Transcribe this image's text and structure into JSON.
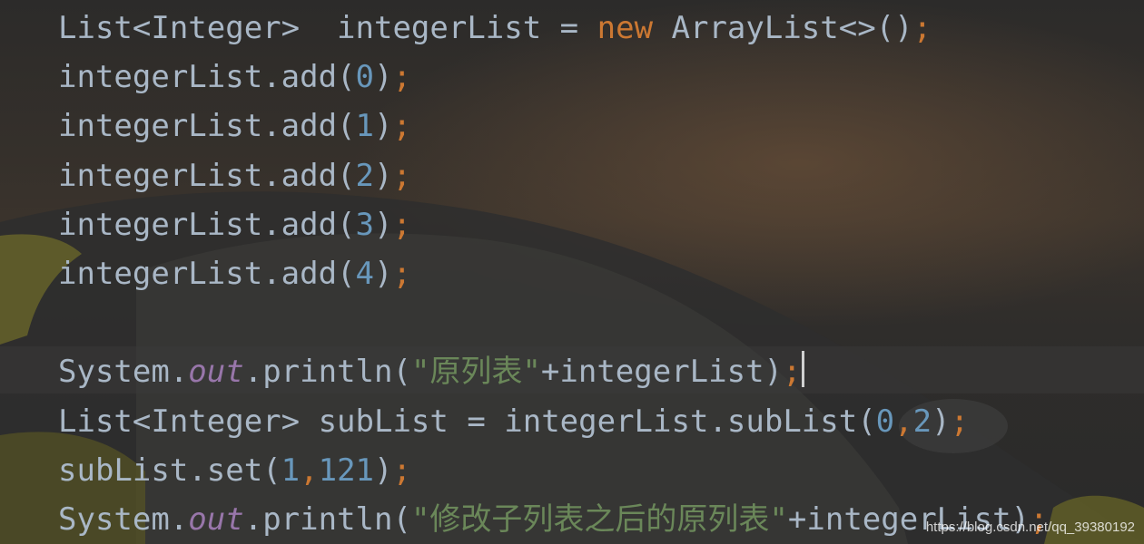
{
  "editor": {
    "theme_colors": {
      "default_text": "#a9b7c6",
      "keyword": "#cc7832",
      "number": "#6897bb",
      "string": "#6a8759",
      "static_field": "#9876aa"
    },
    "lines": [
      {
        "tokens": [
          {
            "text": "List<Integer>  integerList = ",
            "type": "plain"
          },
          {
            "text": "new",
            "type": "keyword"
          },
          {
            "text": " ArrayList<>()",
            "type": "plain"
          },
          {
            "text": ";",
            "type": "punct"
          }
        ]
      },
      {
        "tokens": [
          {
            "text": "integerList.add(",
            "type": "plain"
          },
          {
            "text": "0",
            "type": "number"
          },
          {
            "text": ")",
            "type": "plain"
          },
          {
            "text": ";",
            "type": "punct"
          }
        ]
      },
      {
        "tokens": [
          {
            "text": "integerList.add(",
            "type": "plain"
          },
          {
            "text": "1",
            "type": "number"
          },
          {
            "text": ")",
            "type": "plain"
          },
          {
            "text": ";",
            "type": "punct"
          }
        ]
      },
      {
        "tokens": [
          {
            "text": "integerList.add(",
            "type": "plain"
          },
          {
            "text": "2",
            "type": "number"
          },
          {
            "text": ")",
            "type": "plain"
          },
          {
            "text": ";",
            "type": "punct"
          }
        ]
      },
      {
        "tokens": [
          {
            "text": "integerList.add(",
            "type": "plain"
          },
          {
            "text": "3",
            "type": "number"
          },
          {
            "text": ")",
            "type": "plain"
          },
          {
            "text": ";",
            "type": "punct"
          }
        ]
      },
      {
        "tokens": [
          {
            "text": "integerList.add(",
            "type": "plain"
          },
          {
            "text": "4",
            "type": "number"
          },
          {
            "text": ")",
            "type": "plain"
          },
          {
            "text": ";",
            "type": "punct"
          }
        ]
      },
      {
        "tokens": []
      },
      {
        "tokens": [
          {
            "text": "System.",
            "type": "plain"
          },
          {
            "text": "out",
            "type": "field"
          },
          {
            "text": ".println(",
            "type": "plain"
          },
          {
            "text": "\"原列表\"",
            "type": "string"
          },
          {
            "text": "+integerList)",
            "type": "plain"
          },
          {
            "text": ";",
            "type": "punct"
          }
        ],
        "has_caret": true
      },
      {
        "tokens": [
          {
            "text": "List<Integer> subList = integerList.subList(",
            "type": "plain"
          },
          {
            "text": "0",
            "type": "number"
          },
          {
            "text": ",",
            "type": "punct"
          },
          {
            "text": "2",
            "type": "number"
          },
          {
            "text": ")",
            "type": "plain"
          },
          {
            "text": ";",
            "type": "punct"
          }
        ]
      },
      {
        "tokens": [
          {
            "text": "subList.set(",
            "type": "plain"
          },
          {
            "text": "1",
            "type": "number"
          },
          {
            "text": ",",
            "type": "punct"
          },
          {
            "text": "121",
            "type": "number"
          },
          {
            "text": ")",
            "type": "plain"
          },
          {
            "text": ";",
            "type": "punct"
          }
        ]
      },
      {
        "tokens": [
          {
            "text": "System.",
            "type": "plain"
          },
          {
            "text": "out",
            "type": "field"
          },
          {
            "text": ".println(",
            "type": "plain"
          },
          {
            "text": "\"修改子列表之后的原列表\"",
            "type": "string"
          },
          {
            "text": "+integerList)",
            "type": "plain"
          },
          {
            "text": ";",
            "type": "punct"
          }
        ]
      }
    ]
  },
  "watermark": {
    "text": "https://blog.csdn.net/qq_39380192"
  }
}
